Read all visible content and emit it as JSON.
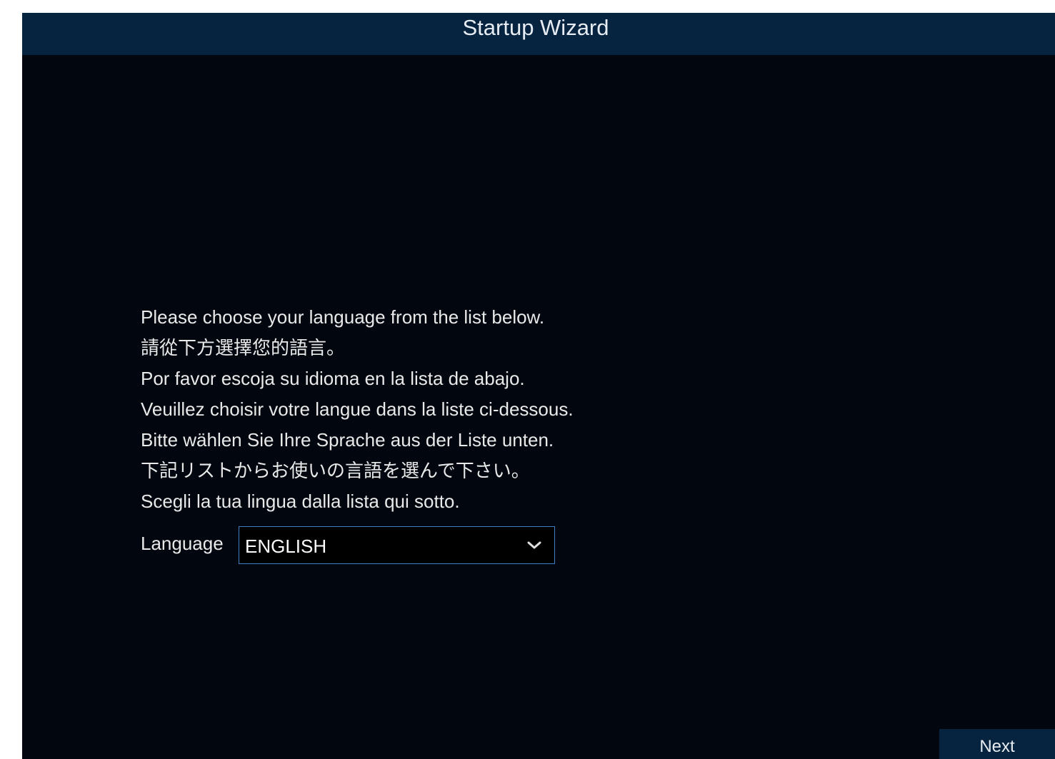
{
  "window": {
    "title": "Startup Wizard"
  },
  "instructions": [
    "Please choose your language from the list below.",
    "請從下方選擇您的語言。",
    "Por favor escoja su idioma en la lista de abajo.",
    "Veuillez choisir votre langue dans la liste ci-dessous.",
    "Bitte wählen Sie Ihre Sprache aus der Liste unten.",
    "下記リストからお使いの言語を選んで下さい。",
    "Scegli la tua lingua dalla lista qui sotto."
  ],
  "language": {
    "label": "Language",
    "selected": "ENGLISH",
    "icon": "chevron-down-icon"
  },
  "footer": {
    "next_label": "Next"
  },
  "colors": {
    "background": "#02060f",
    "titlebar": "#062440",
    "select_border": "#3f7fc6",
    "text": "#e9e9e9"
  }
}
